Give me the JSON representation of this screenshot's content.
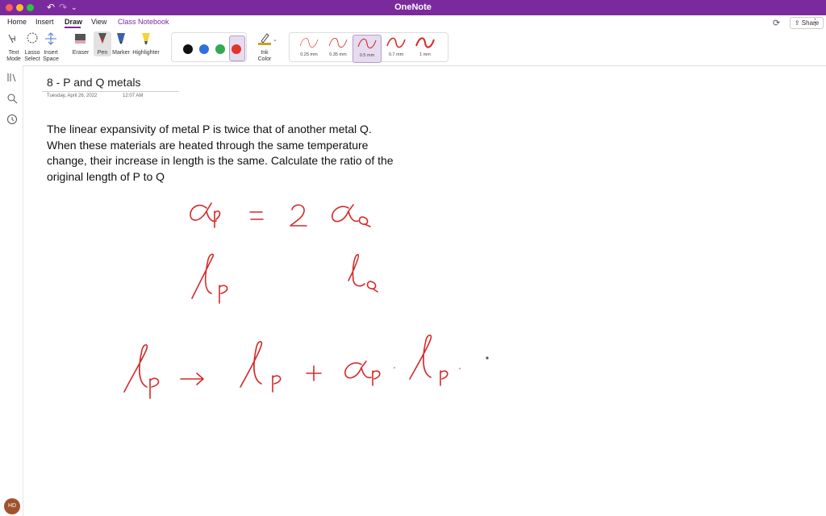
{
  "window": {
    "title": "OneNote"
  },
  "titlebar": {
    "share_label": "Share"
  },
  "tabs": [
    "Home",
    "Insert",
    "Draw",
    "View",
    "Class Notebook"
  ],
  "tools": {
    "text_mode": [
      "Text",
      "Mode"
    ],
    "lasso_select": [
      "Lasso",
      "Select"
    ],
    "insert_space": [
      "Insert",
      "Space"
    ],
    "eraser": "Eraser",
    "pen": "Pen",
    "marker": "Marker",
    "highlighter": "Highlighter",
    "ink_color": [
      "Ink",
      "Color"
    ]
  },
  "pen_colors": [
    "#111111",
    "#2f6fe0",
    "#34a853",
    "#e0352b"
  ],
  "thicknesses": [
    "0.25 mm",
    "0.35 mm",
    "0.5 mm",
    "0.7 mm",
    "1 mm"
  ],
  "page": {
    "title": "8 - P and Q metals",
    "date": "Tuesday, April 26, 2022",
    "time": "12:07 AM",
    "question": "The linear expansivity of metal P is twice that of another metal Q. When these materials are heated through the same temperature change, their increase in length is the same. Calculate the ratio of the original length of P to Q"
  },
  "user": {
    "initials": "HD"
  },
  "colors": {
    "brand": "#7b2a9e",
    "ink": "#d42a2a"
  },
  "icons": [
    "undo-icon",
    "redo-icon",
    "sync-icon",
    "share-icon",
    "more-icon",
    "notebooks-icon",
    "search-icon",
    "recent-icon"
  ]
}
